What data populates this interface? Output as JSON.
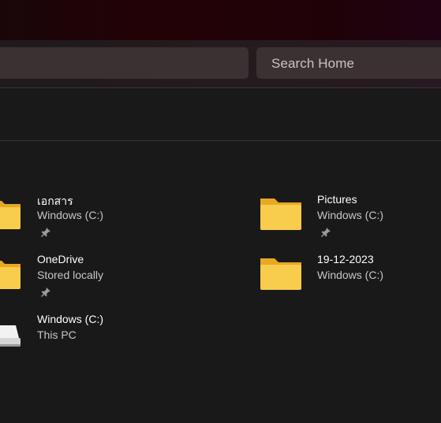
{
  "search": {
    "placeholder": "Search Home"
  },
  "quick_access": [
    {
      "name": "เอกสาร",
      "location": "Windows (C:)",
      "pinned": true,
      "icon": "folder-icon"
    },
    {
      "name": "Pictures",
      "location": "Windows (C:)",
      "pinned": true,
      "icon": "folder-icon"
    },
    {
      "name": "OneDrive",
      "location": "Stored locally",
      "pinned": true,
      "icon": "folder-icon"
    },
    {
      "name": "19-12-2023",
      "location": "Windows (C:)",
      "pinned": false,
      "icon": "folder-icon"
    },
    {
      "name": "Windows (C:)",
      "location": "This PC",
      "pinned": false,
      "icon": "drive-icon"
    }
  ],
  "colors": {
    "background": "#191919",
    "folder": "#f5c242",
    "text_secondary": "#c7c7c7"
  }
}
